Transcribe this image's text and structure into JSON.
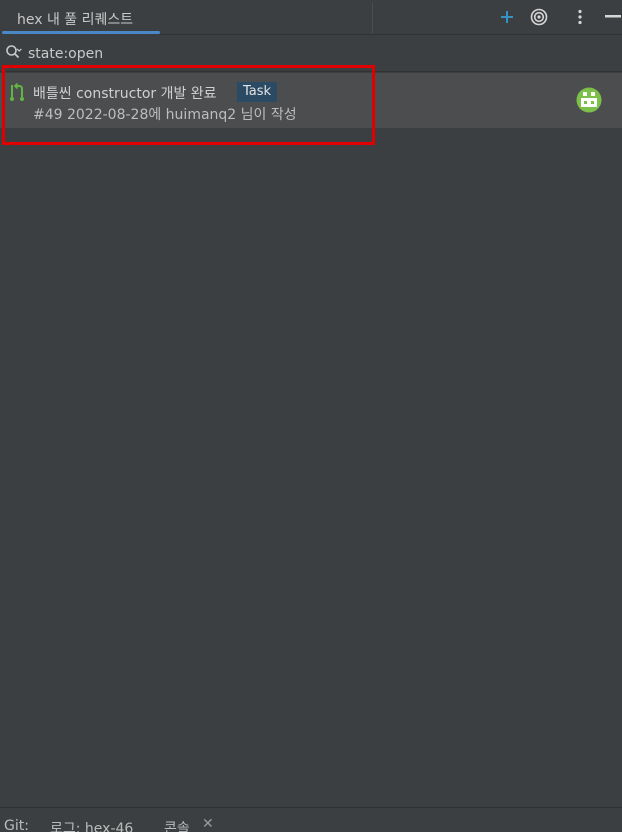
{
  "tab": {
    "label": "hex 내 풀 리퀘스트"
  },
  "toolbar": {
    "add_icon": "plus-icon",
    "target_icon": "target-icon",
    "more_icon": "more-vertical-icon",
    "minimize_icon": "minimize-icon"
  },
  "search": {
    "value": "state:open",
    "icon": "search-icon"
  },
  "pull_requests": [
    {
      "icon": "pull-request-icon",
      "title": "배틀씬 constructor 개발 완료",
      "label": "Task",
      "meta": "#49 2022-08-28에 huimanq2 님이 작성",
      "avatar": "avatar-icon"
    }
  ],
  "bottom_bar": {
    "git_label": "Git:",
    "log_tab": "로그: hex-46",
    "console_tab": "콘솔",
    "close_icon": "close-icon"
  },
  "colors": {
    "accent": "#4a88c7",
    "pr_icon": "#62b543",
    "label_bg": "#2b4a63",
    "highlight": "#e00000",
    "add_icon": "#3592c4"
  }
}
